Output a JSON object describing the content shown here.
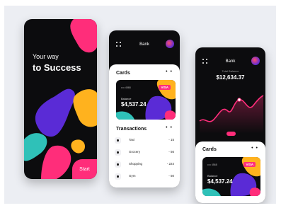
{
  "phone1": {
    "subtitle": "Your way",
    "title": "to Success",
    "start_label": "Start"
  },
  "phone2": {
    "header_title": "Bank",
    "cards_title": "Cards",
    "card": {
      "number": "•••• 4568",
      "network": "VISA",
      "balance_label": "Balance",
      "balance": "$4,537.24"
    },
    "transactions_title": "Transactions",
    "transactions": [
      {
        "name": "Taxi",
        "amount": "- 15"
      },
      {
        "name": "Grocery",
        "amount": "- 56"
      },
      {
        "name": "Shopping",
        "amount": "- 224"
      },
      {
        "name": "Gym",
        "amount": "- 50"
      }
    ]
  },
  "phone3": {
    "header_title": "Bank",
    "balance_label": "Total Balance",
    "balance": "$12,634.37",
    "cards_title": "Cards",
    "card": {
      "number": "•••• 4568",
      "network": "VISA",
      "balance_label": "Balance",
      "balance": "$4,537.24"
    }
  },
  "colors": {
    "pink": "#ff2d7a",
    "purple": "#5a2bd6",
    "teal": "#2fc1b8",
    "yellow": "#ffb21e",
    "dark": "#0c0c0e"
  }
}
